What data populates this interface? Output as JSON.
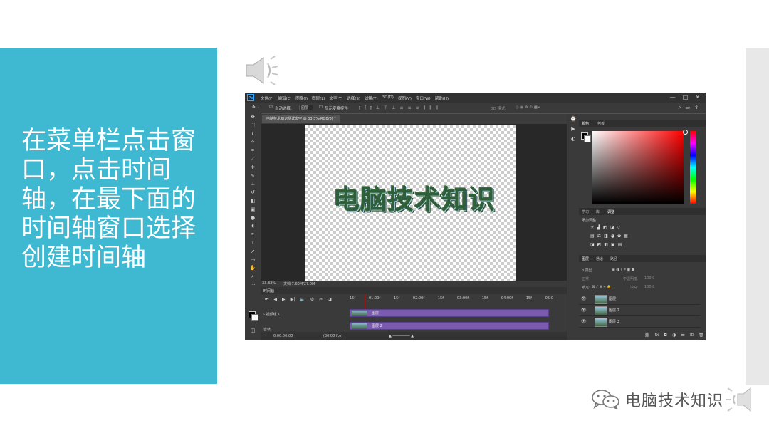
{
  "slide": {
    "instruction": "在菜单栏点击窗口，点击时间轴，在最下面的时间轴窗口选择创建时间轴",
    "watermark": "电脑技术知识"
  },
  "photoshop": {
    "logo": "Ps",
    "menu": [
      "文件(F)",
      "编辑(E)",
      "图像(I)",
      "图层(L)",
      "文字(Y)",
      "选择(S)",
      "滤镜(T)",
      "3D(D)",
      "视图(V)",
      "窗口(W)",
      "帮助(H)"
    ],
    "window_controls": [
      "—",
      "□",
      "✕"
    ],
    "options": {
      "auto_select_label": "自动选择:",
      "auto_select_value": "图层",
      "show_transform_label": "显示变换控件",
      "mode_3d_label": "3D 模式:"
    },
    "document_tab": "电脑技术知识测试文字 @ 33.3%(RGB/8) *",
    "canvas_text": "电脑技术知识",
    "status": {
      "zoom": "33.33%",
      "doc": "文档:7.60M/27.0M"
    },
    "timeline": {
      "panel_title": "时间轴",
      "ruler": [
        "15f",
        "01:00f",
        "15f",
        "02:00f",
        "15f",
        "03:00f",
        "15f",
        "04:00f",
        "15f",
        "05:0"
      ],
      "tracks": [
        {
          "label": "视频组 1",
          "clip": "图层"
        },
        {
          "label": "",
          "clip": "图层 2"
        }
      ],
      "audio_label": "音轨",
      "timecode": "0:00:00:00",
      "fps": "(30.00 fps)"
    },
    "right_panel": {
      "color_tabs": [
        "颜色",
        "色板"
      ],
      "color_fg": "#000000",
      "color_bg": "#ffffff",
      "adjust_tabs": [
        "学习",
        "库",
        "调整"
      ],
      "adjust_label": "添加调整",
      "layer_tabs": [
        "图层",
        "通道",
        "路径"
      ],
      "layer_kind": "ρ 类型",
      "blend_mode": "正常",
      "opacity_label": "不透明度:",
      "opacity_value": "100%",
      "lock_label": "锁定:",
      "fill_label": "填充:",
      "fill_value": "100%",
      "layers": [
        "图层",
        "图层 2",
        "图层 3"
      ]
    }
  }
}
